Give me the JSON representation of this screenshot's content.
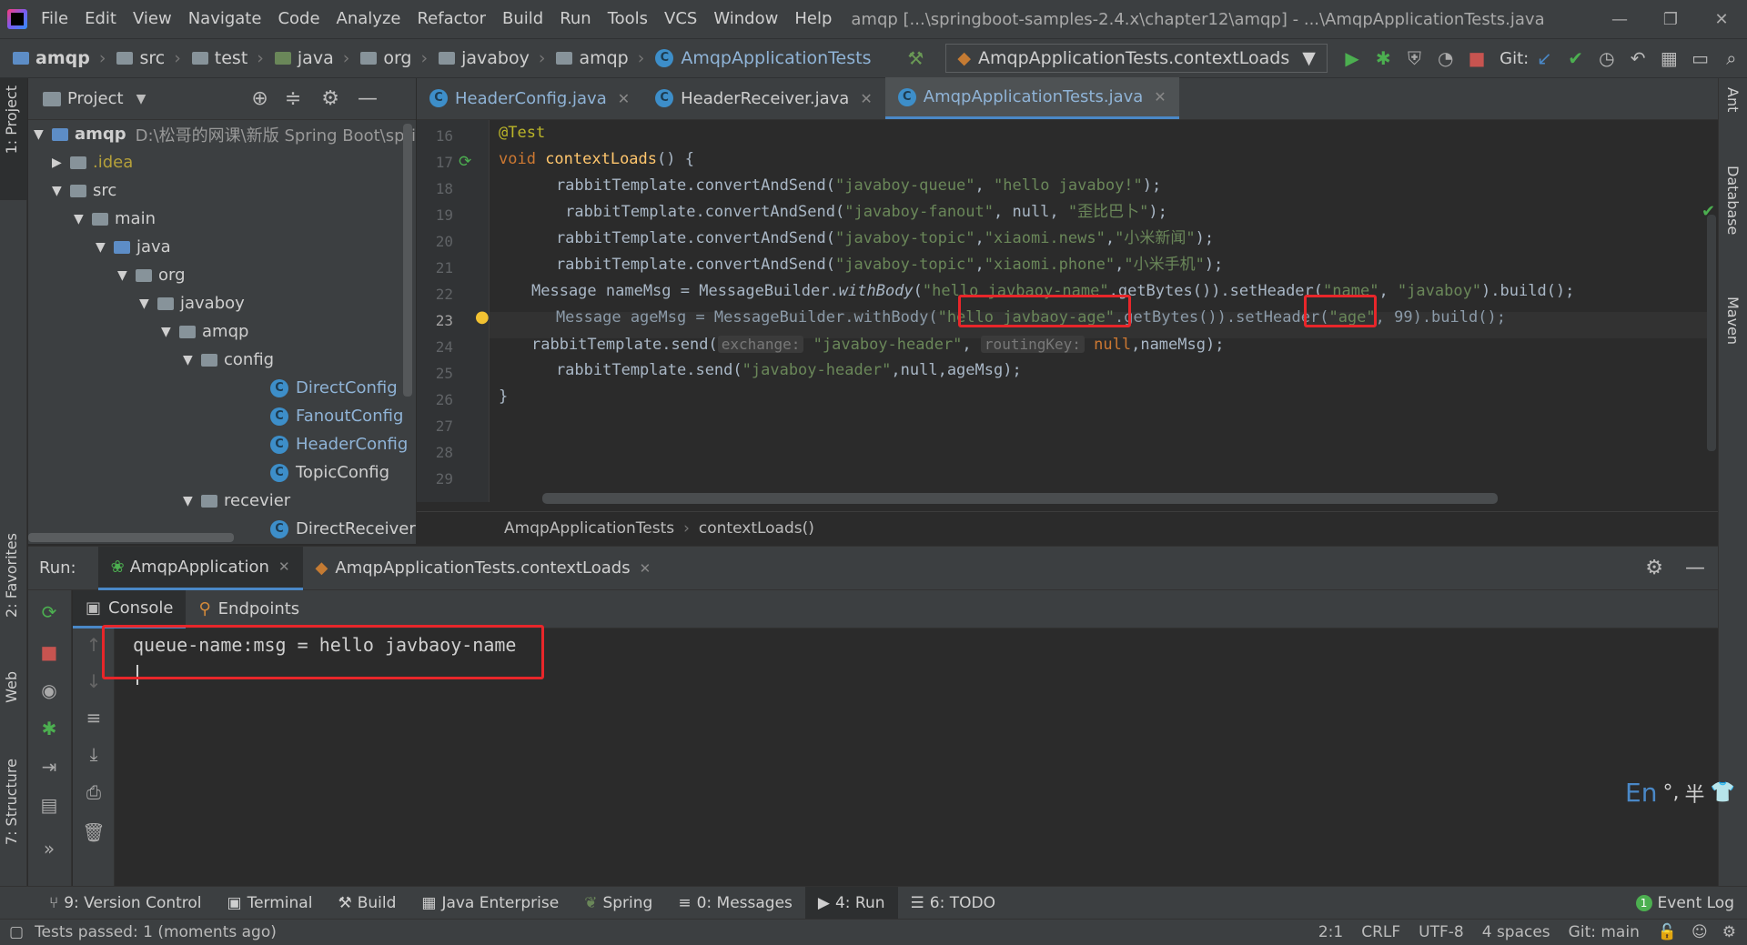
{
  "menu": [
    "File",
    "Edit",
    "View",
    "Navigate",
    "Code",
    "Analyze",
    "Refactor",
    "Build",
    "Run",
    "Tools",
    "VCS",
    "Window",
    "Help"
  ],
  "window_title": "amqp [...\\springboot-samples-2.4.x\\chapter12\\amqp] - ...\\AmqpApplicationTests.java",
  "breadcrumbs": [
    "amqp",
    "src",
    "test",
    "java",
    "org",
    "javaboy",
    "amqp",
    "AmqpApplicationTests"
  ],
  "run_config": "AmqpApplicationTests.contextLoads",
  "git_label": "Git:",
  "project_panel": {
    "title": "Project",
    "tree": [
      {
        "label": "amqp",
        "extra": "D:\\松哥的网课\\新版 Spring Boot\\spring",
        "type": "module",
        "expanded": true
      },
      {
        "label": ".idea",
        "type": "folder",
        "expanded": false
      },
      {
        "label": "src",
        "type": "folder",
        "expanded": true
      },
      {
        "label": "main",
        "type": "folder",
        "expanded": true
      },
      {
        "label": "java",
        "type": "folder",
        "expanded": true
      },
      {
        "label": "org",
        "type": "folder",
        "expanded": true
      },
      {
        "label": "javaboy",
        "type": "folder",
        "expanded": true
      },
      {
        "label": "amqp",
        "type": "folder",
        "expanded": true
      },
      {
        "label": "config",
        "type": "folder",
        "expanded": true
      },
      {
        "label": "DirectConfig",
        "type": "class"
      },
      {
        "label": "FanoutConfig",
        "type": "class"
      },
      {
        "label": "HeaderConfig",
        "type": "class"
      },
      {
        "label": "TopicConfig",
        "type": "class"
      },
      {
        "label": "recevier",
        "type": "folder",
        "expanded": true
      },
      {
        "label": "DirectReceiver",
        "type": "class"
      }
    ]
  },
  "editor_tabs": [
    {
      "label": "HeaderConfig.java",
      "active": false
    },
    {
      "label": "HeaderReceiver.java",
      "active": false
    },
    {
      "label": "AmqpApplicationTests.java",
      "active": true
    }
  ],
  "line_numbers": [
    "16",
    "17",
    "18",
    "19",
    "20",
    "21",
    "22",
    "23",
    "24",
    "25",
    "26",
    "27",
    "28",
    "29"
  ],
  "code": {
    "l16": "@Test",
    "l17a": "void ",
    "l17b": "contextLoads",
    "l17c": "() {",
    "l18a": "    rabbitTemplate.convertAndSend(",
    "l18b": "\"javaboy-queue\"",
    "l18c": ", ",
    "l18d": "\"hello javaboy!\"",
    "l18e": ");",
    "l19a": "     rabbitTemplate.convertAndSend(",
    "l19b": "\"javaboy-fanout\"",
    "l19c": ", null, ",
    "l19d": "\"歪比巴卜\"",
    "l19e": ");",
    "l20a": "    rabbitTemplate.convertAndSend(",
    "l20b": "\"javaboy-topic\"",
    "l20c": ",",
    "l20d": "\"xiaomi.news\"",
    "l20e": ",",
    "l20f": "\"小米新闻\"",
    "l20g": ");",
    "l21a": "    rabbitTemplate.convertAndSend(",
    "l21b": "\"javaboy-topic\"",
    "l21c": ",",
    "l21d": "\"xiaomi.phone\"",
    "l21e": ",",
    "l21f": "\"小米手机\"",
    "l21g": ");",
    "l22a": "Message nameMsg = MessageBuilder.",
    "l22b": "withBody",
    "l22c": "(",
    "l22d": "\"hello javbaoy-name\"",
    "l22e": ".getBytes()).setHeader(",
    "l22f": "\"name\"",
    "l22g": ", ",
    "l22h": "\"javaboy\"",
    "l22i": ").build();",
    "l23a": "    Message ageMsg = MessageBuilder.withBody(",
    "l23b": "\"hello javbaoy-age\"",
    "l23c": ".getBytes()).setHeader(",
    "l23d": "\"age\"",
    "l23e": ", 99).build();",
    "l24a": "rabbitTemplate.send(",
    "l24hint1": "exchange:",
    "l24b": "\"javaboy-header\"",
    "l24c": ",",
    "l24hint2": "routingKey:",
    "l24d": "null",
    "l24e": ",nameMsg);",
    "l25a": "    rabbitTemplate.send(",
    "l25b": "\"javaboy-header\"",
    "l25c": ",null,ageMsg);",
    "l26": "}"
  },
  "code_breadcrumb": [
    "AmqpApplicationTests",
    "contextLoads()"
  ],
  "run_panel": {
    "label": "Run:",
    "tabs": [
      "AmqpApplication",
      "AmqpApplicationTests.contextLoads"
    ],
    "subtabs": [
      "Console",
      "Endpoints"
    ],
    "console_output": "queue-name:msg = hello javbaoy-name"
  },
  "ime": {
    "en": "En",
    "punct": "°,",
    "half": "半"
  },
  "left_strip": [
    "1: Project",
    "2: Favorites",
    "Web",
    "7: Structure"
  ],
  "right_strip": [
    "Ant",
    "Database",
    "Maven"
  ],
  "bottom_tools": [
    "9: Version Control",
    "Terminal",
    "Build",
    "Java Enterprise",
    "Spring",
    "0: Messages",
    "4: Run",
    "6: TODO"
  ],
  "event_log": {
    "count": "1",
    "label": "Event Log"
  },
  "status": {
    "message": "Tests passed: 1 (moments ago)",
    "position": "2:1",
    "line_sep": "CRLF",
    "encoding": "UTF-8",
    "indent": "4 spaces",
    "git": "Git: main"
  }
}
